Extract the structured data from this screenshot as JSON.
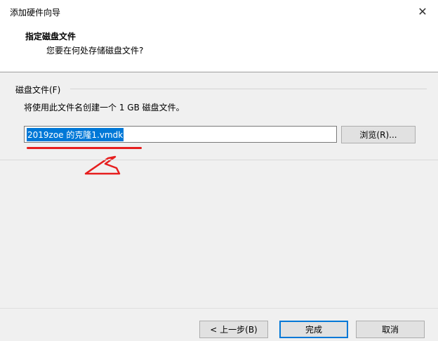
{
  "window": {
    "title": "添加硬件向导",
    "close_glyph": "✕"
  },
  "header": {
    "title": "指定磁盘文件",
    "subtitle": "您要在何处存储磁盘文件?"
  },
  "disk_file": {
    "group_label": "磁盘文件(F)",
    "description": "将使用此文件名创建一个 1 GB 磁盘文件。",
    "value": "2019zoe 的克隆1.vmdk",
    "browse_label": "浏览(R)..."
  },
  "footer": {
    "back_label": "< 上一步(B)",
    "finish_label": "完成",
    "cancel_label": "取消"
  },
  "colors": {
    "selection": "#0078d7",
    "annotation": "#e61e1e",
    "panel": "#f0f0f0"
  }
}
